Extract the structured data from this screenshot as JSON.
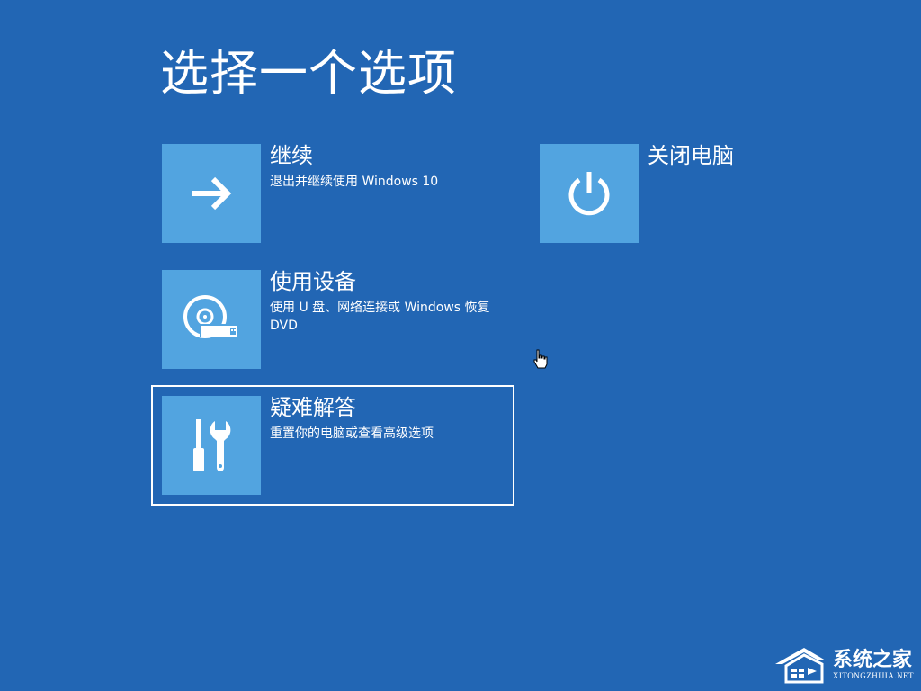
{
  "page": {
    "title": "选择一个选项",
    "background_color": "#2266b4",
    "tile_color": "#52a4e0"
  },
  "options": [
    {
      "id": "continue",
      "title": "继续",
      "description": "退出并继续使用 Windows 10",
      "icon": "arrow-right-icon",
      "focused": false
    },
    {
      "id": "use-device",
      "title": "使用设备",
      "description": "使用 U 盘、网络连接或 Windows 恢复 DVD",
      "icon": "disc-usb-icon",
      "focused": false
    },
    {
      "id": "troubleshoot",
      "title": "疑难解答",
      "description": "重置你的电脑或查看高级选项",
      "icon": "tools-icon",
      "focused": true
    },
    {
      "id": "shutdown",
      "title": "关闭电脑",
      "description": "",
      "icon": "power-icon",
      "focused": false
    }
  ],
  "watermark": {
    "name": "系统之家",
    "url": "XITONGZHIJIA.NET",
    "icon": "house-logo-icon"
  }
}
